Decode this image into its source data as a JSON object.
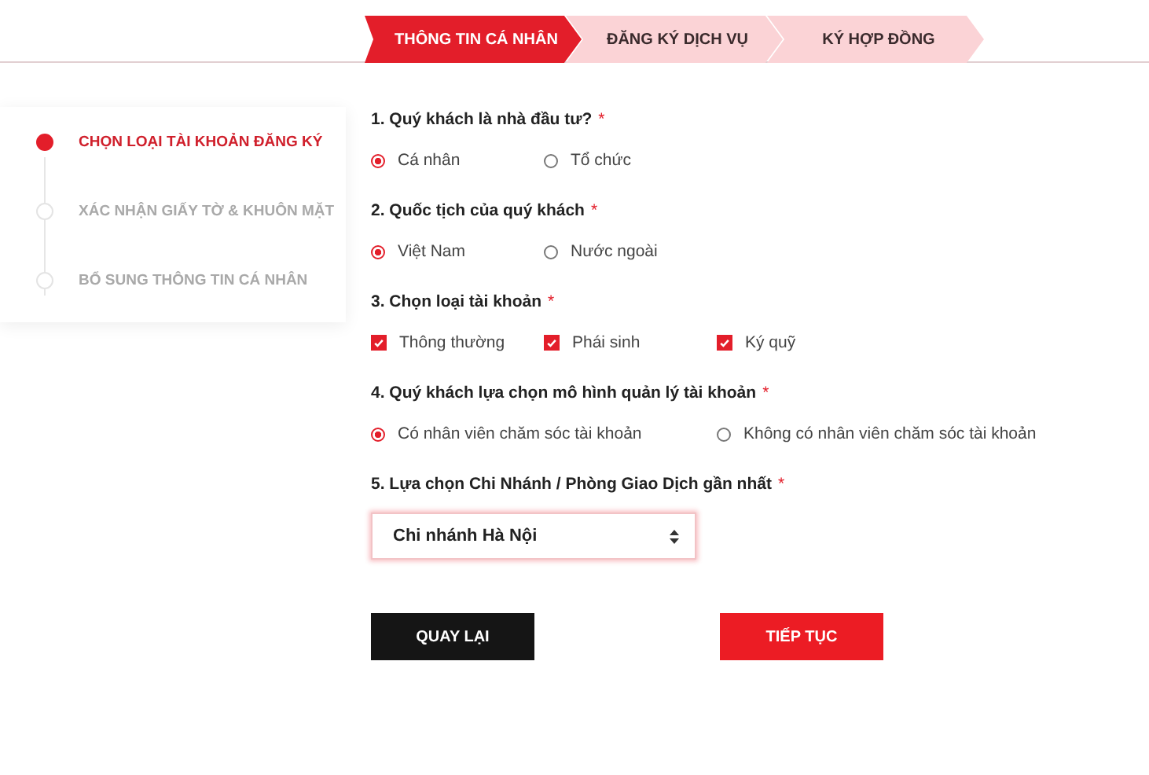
{
  "steps": [
    {
      "label": "THÔNG TIN CÁ NHÂN",
      "selected": true
    },
    {
      "label": "ĐĂNG KÝ DỊCH VỤ",
      "selected": false
    },
    {
      "label": "KÝ HỢP ĐỒNG",
      "selected": false
    }
  ],
  "sidebar": {
    "items": [
      {
        "label": "CHỌN LOẠI TÀI KHOẢN ĐĂNG KÝ",
        "selected": true
      },
      {
        "label": "XÁC NHẬN GIẤY TỜ & KHUÔN MẶT",
        "selected": false
      },
      {
        "label": "BỔ SUNG THÔNG TIN CÁ NHÂN",
        "selected": false
      }
    ]
  },
  "questions": [
    {
      "kind": "radio",
      "label": "1. Quý khách là nhà đầu tư?",
      "required_mark": "*",
      "options": [
        {
          "label": "Cá nhân",
          "selected": true
        },
        {
          "label": "Tổ chức",
          "selected": false
        }
      ]
    },
    {
      "kind": "radio",
      "label": "2. Quốc tịch của quý khách",
      "required_mark": "*",
      "options": [
        {
          "label": "Việt Nam",
          "selected": true
        },
        {
          "label": "Nước ngoài",
          "selected": false
        }
      ]
    },
    {
      "kind": "checkbox",
      "label": "3. Chọn loại tài khoản",
      "required_mark": "*",
      "options": [
        {
          "label": "Thông thường",
          "checked": true
        },
        {
          "label": "Phái sinh",
          "checked": true
        },
        {
          "label": "Ký quỹ",
          "checked": true
        }
      ]
    },
    {
      "kind": "radio",
      "label": "4. Quý khách lựa chọn mô hình quản lý tài khoản",
      "required_mark": "*",
      "options": [
        {
          "label": "Có nhân viên chăm sóc tài khoản",
          "selected": true
        },
        {
          "label": "Không có nhân viên chăm sóc tài khoản",
          "selected": false
        }
      ]
    },
    {
      "kind": "select",
      "label": "5. Lựa chọn Chi Nhánh / Phòng Giao Dịch gần nhất",
      "required_mark": "*",
      "value": "Chi nhánh Hà Nội"
    }
  ],
  "buttons": [
    {
      "label": "QUAY LẠI",
      "kind": "secondary"
    },
    {
      "label": "TIẾP TỤC",
      "kind": "primary"
    }
  ]
}
